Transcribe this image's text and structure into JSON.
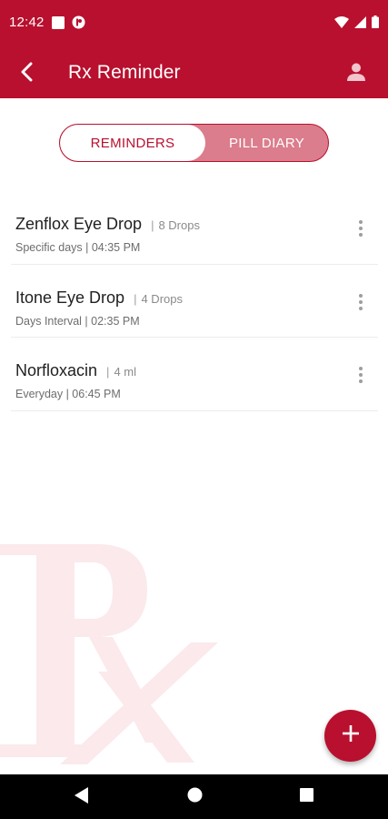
{
  "status_bar": {
    "time": "12:42",
    "left_icons": [
      "square-notification-icon",
      "app-notification-icon"
    ],
    "right_icons": [
      "wifi-icon",
      "signal-icon",
      "battery-icon"
    ]
  },
  "app_bar": {
    "title": "Rx Reminder",
    "back_icon": "back-arrow-icon",
    "profile_icon": "person-icon"
  },
  "tabs": [
    {
      "label": "REMINDERS",
      "active": true
    },
    {
      "label": "PILL DIARY",
      "active": false
    }
  ],
  "medications": [
    {
      "name": "Zenflox Eye Drop",
      "separator": "|",
      "dose": "8 Drops",
      "schedule": "Specific days | 04:35 PM"
    },
    {
      "name": "Itone Eye Drop",
      "separator": "|",
      "dose": "4 Drops",
      "schedule": "Days Interval | 02:35 PM"
    },
    {
      "name": "Norfloxacin",
      "separator": "|",
      "dose": "4 ml",
      "schedule": "Everyday | 06:45 PM"
    }
  ],
  "watermark": {
    "text": "Rx"
  },
  "fab": {
    "icon": "plus-icon"
  },
  "nav_bar": {
    "icons": [
      "back-triangle-icon",
      "home-circle-icon",
      "recents-square-icon"
    ]
  },
  "colors": {
    "primary": "#b8102e",
    "tab_inactive_bg": "#db7d8c",
    "watermark": "#fbe9ec",
    "divider": "#ececec"
  }
}
